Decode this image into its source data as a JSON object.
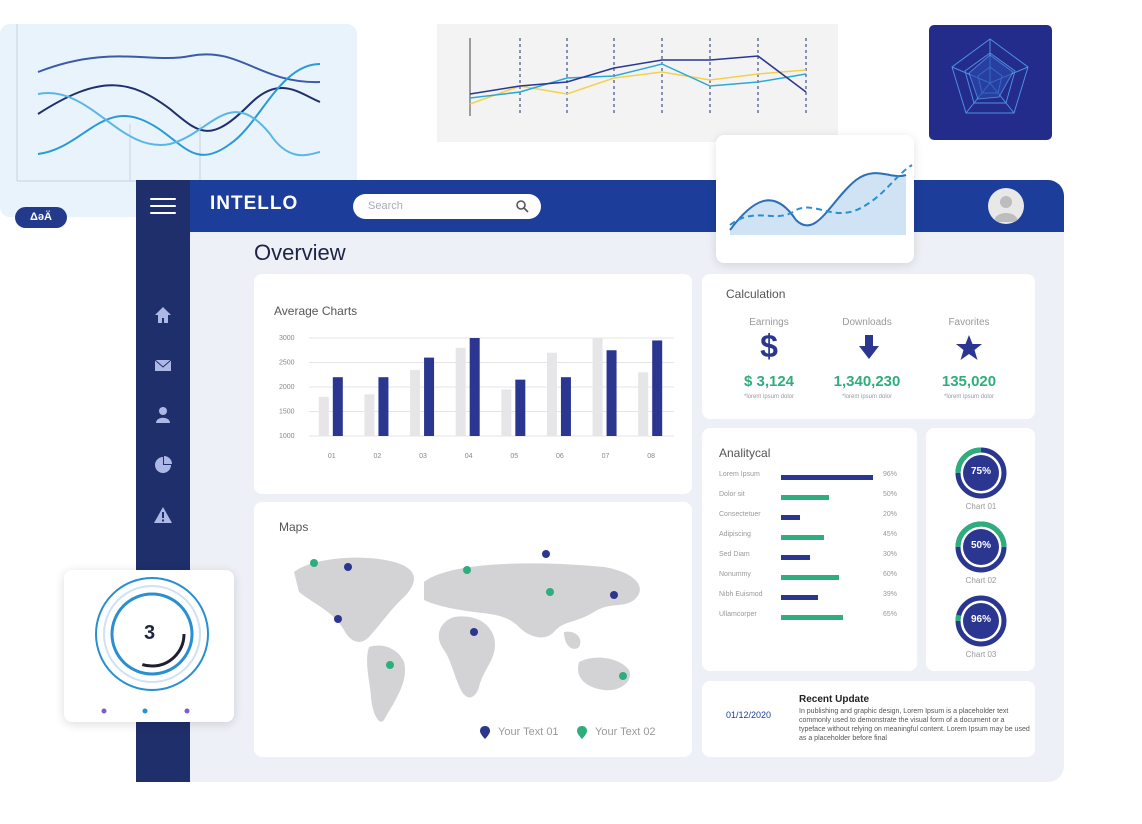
{
  "badge": {
    "label": "ΔəÄ"
  },
  "app": {
    "name": "INTELLO"
  },
  "search": {
    "placeholder": "Search"
  },
  "page": {
    "title": "Overview"
  },
  "sidebar": {
    "icons": [
      "home-icon",
      "mail-icon",
      "user-icon",
      "pie-chart-icon",
      "warning-icon"
    ]
  },
  "colors": {
    "navy": "#1f2f6b",
    "blue": "#1c3e9a",
    "bar_dark": "#2a3690",
    "bar_light": "#e6e6e8",
    "green": "#2eae7c",
    "page_bg": "#eef0f7"
  },
  "average_charts": {
    "title": "Average Charts",
    "chart_data": {
      "type": "bar",
      "categories": [
        "01",
        "02",
        "03",
        "04",
        "05",
        "06",
        "07",
        "08"
      ],
      "series": [
        {
          "values": [
            1800,
            1850,
            2350,
            2800,
            1950,
            2700,
            3000,
            2300
          ]
        },
        {
          "values": [
            2200,
            2200,
            2600,
            3000,
            2150,
            2200,
            2750,
            2950
          ]
        }
      ],
      "yticks": [
        "3000",
        "2500",
        "2000",
        "1500",
        "1000"
      ],
      "ylim": [
        1000,
        3000
      ]
    }
  },
  "calculation": {
    "title": "Calculation",
    "items": [
      {
        "label": "Earnings",
        "value": "$ 3,124",
        "sub": "*lorem ipsum dolor",
        "icon": "dollar-icon"
      },
      {
        "label": "Downloads",
        "value": "1,340,230",
        "sub": "*lorem ipsum dolor",
        "icon": "download-arrow-icon"
      },
      {
        "label": "Favorites",
        "value": "135,020",
        "sub": "*lorem ipsum dolor",
        "icon": "star-icon"
      }
    ]
  },
  "analytical": {
    "title": "Analitycal",
    "rows": [
      {
        "label": "Lorem Ipsum",
        "value": 96,
        "pct": "96%"
      },
      {
        "label": "Dolor sit",
        "value": 50,
        "pct": "50%"
      },
      {
        "label": "Consectetuer",
        "value": 20,
        "pct": "20%"
      },
      {
        "label": "Adipiscing",
        "value": 45,
        "pct": "45%"
      },
      {
        "label": "Sed Diam",
        "value": 30,
        "pct": "30%"
      },
      {
        "label": "Nonummy",
        "value": 60,
        "pct": "60%"
      },
      {
        "label": "Nibh Euismod",
        "value": 39,
        "pct": "39%"
      },
      {
        "label": "Ullamcorper",
        "value": 65,
        "pct": "65%"
      }
    ]
  },
  "rings": [
    {
      "pct": "75%",
      "value": 75,
      "label": "Chart 01"
    },
    {
      "pct": "50%",
      "value": 50,
      "label": "Chart 02"
    },
    {
      "pct": "96%",
      "value": 96,
      "label": "Chart 03"
    }
  ],
  "maps": {
    "title": "Maps",
    "legend": [
      "Your Text 01",
      "Your Text 02"
    ]
  },
  "recent_update": {
    "title": "Recent Update",
    "date": "01/12/2020",
    "text": "In publishing and graphic design, Lorem Ipsum is a placeholder text commonly used to demonstrate the visual form of a document or a typeface without relying on meaningful content. Lorem Ipsum may be used as a placeholder before final"
  },
  "donut_card": {
    "number": "3"
  }
}
